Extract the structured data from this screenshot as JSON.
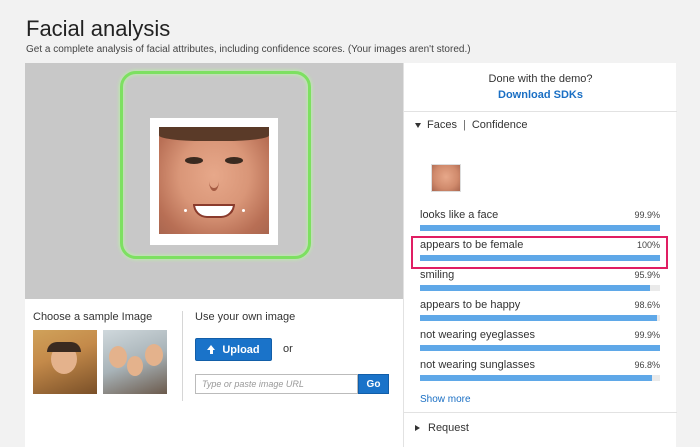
{
  "header": {
    "title": "Facial analysis",
    "subtitle": "Get a complete analysis of facial attributes, including confidence scores. (Your images aren't stored.)"
  },
  "left": {
    "sample_label": "Choose a sample Image",
    "own_label": "Use your own image",
    "upload_label": "Upload",
    "or_text": "or",
    "url_placeholder": "Type or paste image URL",
    "go_label": "Go"
  },
  "right": {
    "demo_text": "Done with the demo?",
    "sdk_link": "Download SDKs",
    "tab_faces": "Faces",
    "tab_separator": "|",
    "tab_confidence": "Confidence",
    "attributes": [
      {
        "label": "looks like a face",
        "value": "99.9%",
        "fraction": 0.999
      },
      {
        "label": "appears to be female",
        "value": "100%",
        "fraction": 1.0
      },
      {
        "label": "smiling",
        "value": "95.9%",
        "fraction": 0.959
      },
      {
        "label": "appears to be happy",
        "value": "98.6%",
        "fraction": 0.986
      },
      {
        "label": "not wearing eyeglasses",
        "value": "99.9%",
        "fraction": 0.999
      },
      {
        "label": "not wearing sunglasses",
        "value": "96.8%",
        "fraction": 0.968
      }
    ],
    "show_more": "Show more",
    "request_label": "Request"
  },
  "colors": {
    "accent": "#1a73c9",
    "bar": "#5fa8e8",
    "face_box": "#7de061",
    "highlight": "#e01e63"
  }
}
